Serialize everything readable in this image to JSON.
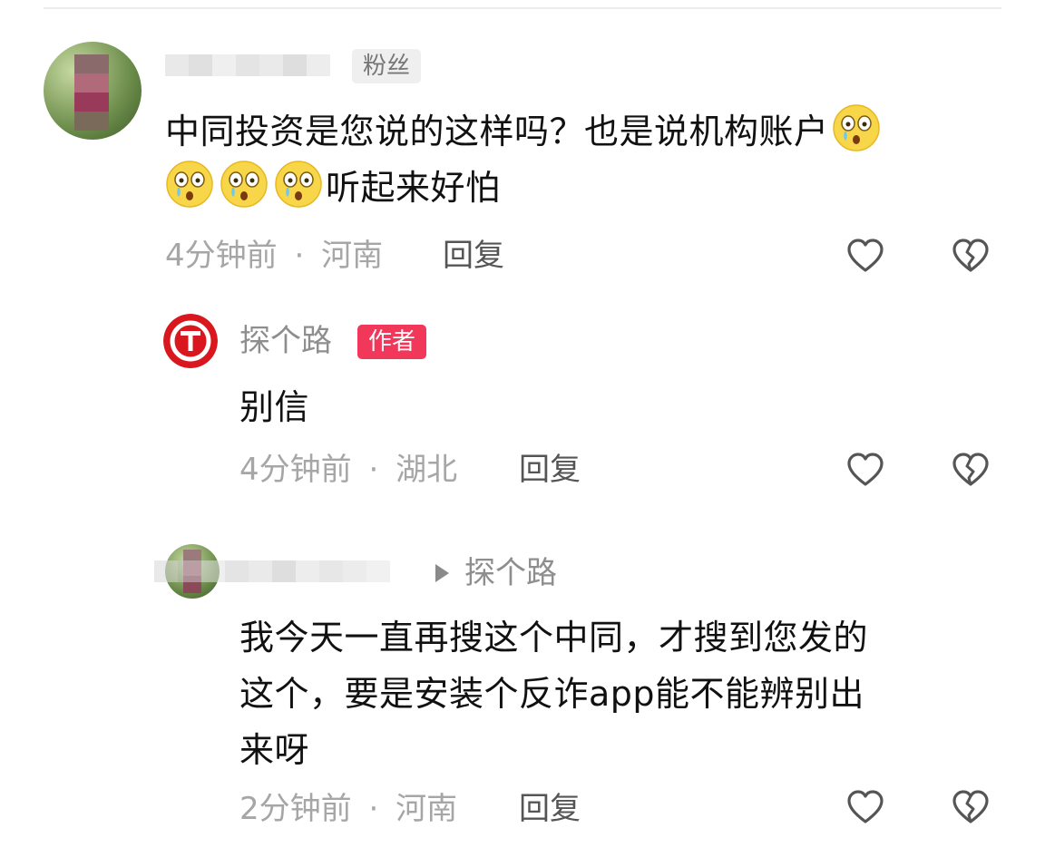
{
  "comments": [
    {
      "tag": "粉丝",
      "text_line1": "中同投资是您说的这样吗？也是说机构账户",
      "text_line2": "听起来好怕",
      "time": "4分钟前",
      "location": "河南",
      "reply": "回复"
    },
    {
      "username": "探个路",
      "tag": "作者",
      "text": "别信",
      "time": "4分钟前",
      "location": "湖北",
      "reply": "回复"
    },
    {
      "reply_to": "探个路",
      "text_line1": "我今天一直再搜这个中同，才搜到您发的",
      "text_line2": "这个，要是安装个反诈app能不能辨别出",
      "text_line3": "来呀",
      "time": "2分钟前",
      "location": "河南",
      "reply": "回复"
    }
  ],
  "separator": "·",
  "icons": [
    "like-heart-icon",
    "dislike-broken-heart-icon",
    "crying-face-emoji",
    "author-logo-icon",
    "reply-arrow-icon"
  ],
  "colors": {
    "author_tag": "#f2385a",
    "author_logo": "#d8171f",
    "meta_text": "#a6a6a6"
  }
}
